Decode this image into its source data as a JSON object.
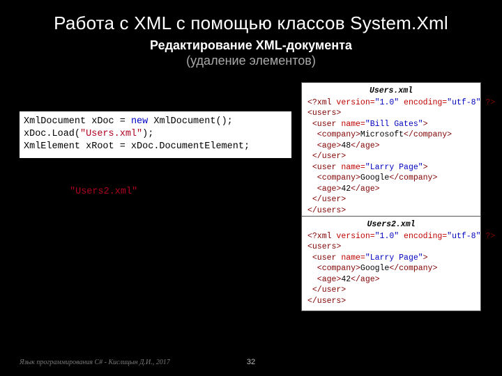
{
  "title": "Работа с XML с помощью классов System.Xml",
  "subtitle1": "Редактирование XML-документа",
  "subtitle2": "(удаление элементов)",
  "code": {
    "c0a": "XmlDocument xDoc = ",
    "c0kw": "new",
    "c0b": " XmlDocument();",
    "c1a": "xDoc.Load(",
    "c1str": "\"Users.xml\"",
    "c1b": ");",
    "c2": "XmlElement xRoot = xDoc.DocumentElement;"
  },
  "hl_str": "\"Users2.xml\"",
  "xml1": {
    "title": "Users.xml",
    "decl_open": "<?xml ",
    "decl_attr1": "version=",
    "decl_val1": "\"1.0\"",
    "decl_attr2": " encoding=",
    "decl_val2": "\"utf-8\"",
    "decl_close": " ?>",
    "users_open": "<users>",
    "u1_open_a": " <user ",
    "u1_attr": "name=",
    "u1_val": "\"Bill Gates\"",
    "u1_open_b": ">",
    "u1_comp_a": "  <company>",
    "u1_comp_t": "Microsoft",
    "u1_comp_b": "</company>",
    "u1_age_a": "  <age>",
    "u1_age_t": "48",
    "u1_age_b": "</age>",
    "u1_close": " </user>",
    "u2_open_a": " <user ",
    "u2_attr": "name=",
    "u2_val": "\"Larry Page\"",
    "u2_open_b": ">",
    "u2_comp_a": "  <company>",
    "u2_comp_t": "Google",
    "u2_comp_b": "</company>",
    "u2_age_a": "  <age>",
    "u2_age_t": "42",
    "u2_age_b": "</age>",
    "u2_close": " </user>",
    "users_close": "</users>"
  },
  "xml2": {
    "title": "Users2.xml",
    "decl_open": "<?xml ",
    "decl_attr1": "version=",
    "decl_val1": "\"1.0\"",
    "decl_attr2": " encoding=",
    "decl_val2": "\"utf-8\"",
    "decl_close": " ?>",
    "users_open": "<users>",
    "u_open_a": " <user ",
    "u_attr": "name=",
    "u_val": "\"Larry Page\"",
    "u_open_b": ">",
    "u_comp_a": "  <company>",
    "u_comp_t": "Google",
    "u_comp_b": "</company>",
    "u_age_a": "  <age>",
    "u_age_t": "42",
    "u_age_b": "</age>",
    "u_close": " </user>",
    "users_close": "</users>"
  },
  "footer_left": "Язык программирования C# - Кислицын Д.И., 2017",
  "footer_num": "32"
}
